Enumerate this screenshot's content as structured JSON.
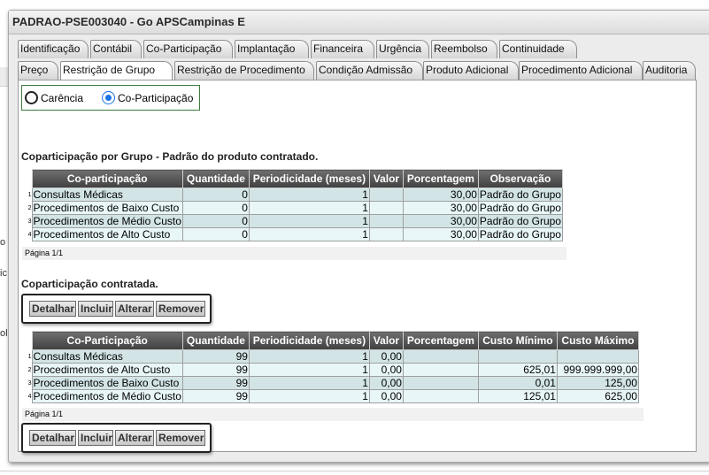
{
  "window": {
    "title": "PADRAO-PSE003040 - Go APSCampinas E"
  },
  "tabs_row1": [
    "Identificação",
    "Contábil",
    "Co-Participação",
    "Implantação",
    "Financeira",
    "Urgência",
    "Reembolso",
    "Continuidade"
  ],
  "tabs_row2": [
    "Preço",
    "Restrição de Grupo",
    "Restrição de Procedimento",
    "Condição Admissão",
    "Produto Adicional",
    "Procedimento Adicional",
    "Auditoria"
  ],
  "radio": {
    "carencia": "Carência",
    "coparticipacao": "Co-Participação"
  },
  "grupo": {
    "title": "Coparticipação por Grupo - Padrão do produto contratado.",
    "headers": [
      "Co-participação",
      "Quantidade",
      "Periodicidade (meses)",
      "Valor",
      "Porcentagem",
      "Observação"
    ],
    "rows": [
      [
        "1",
        "Consultas Médicas",
        "0",
        "1",
        "",
        "30,00",
        "Padrão do Grupo"
      ],
      [
        "2",
        "Procedimentos de Baixo Custo",
        "0",
        "1",
        "",
        "30,00",
        "Padrão do Grupo"
      ],
      [
        "3",
        "Procedimentos de Médio Custo",
        "0",
        "1",
        "",
        "30,00",
        "Padrão do Grupo"
      ],
      [
        "4",
        "Procedimentos de Alto Custo",
        "0",
        "1",
        "",
        "30,00",
        "Padrão do Grupo"
      ]
    ],
    "pager": "Página 1/1"
  },
  "contratada": {
    "title": "Coparticipação contratada.",
    "buttons": [
      "Detalhar",
      "Incluir",
      "Alterar",
      "Remover"
    ],
    "headers": [
      "Co-Participação",
      "Quantidade",
      "Periodicidade (meses)",
      "Valor",
      "Porcentagem",
      "Custo Mínimo",
      "Custo Máximo"
    ],
    "rows": [
      [
        "1",
        "Consultas Médicas",
        "99",
        "1",
        "0,00",
        "",
        "",
        ""
      ],
      [
        "2",
        "Procedimentos de Alto Custo",
        "99",
        "1",
        "0,00",
        "",
        "625,01",
        "999.999.999,00"
      ],
      [
        "3",
        "Procedimentos de Baixo Custo",
        "99",
        "1",
        "0,00",
        "",
        "0,01",
        "125,00"
      ],
      [
        "4",
        "Procedimentos de Médio Custo",
        "99",
        "1",
        "0,00",
        "",
        "125,01",
        "625,00"
      ]
    ],
    "pager": "Página 1/1"
  },
  "backdrop": {
    "fragments": [
      "o",
      "ic",
      "ol"
    ]
  }
}
